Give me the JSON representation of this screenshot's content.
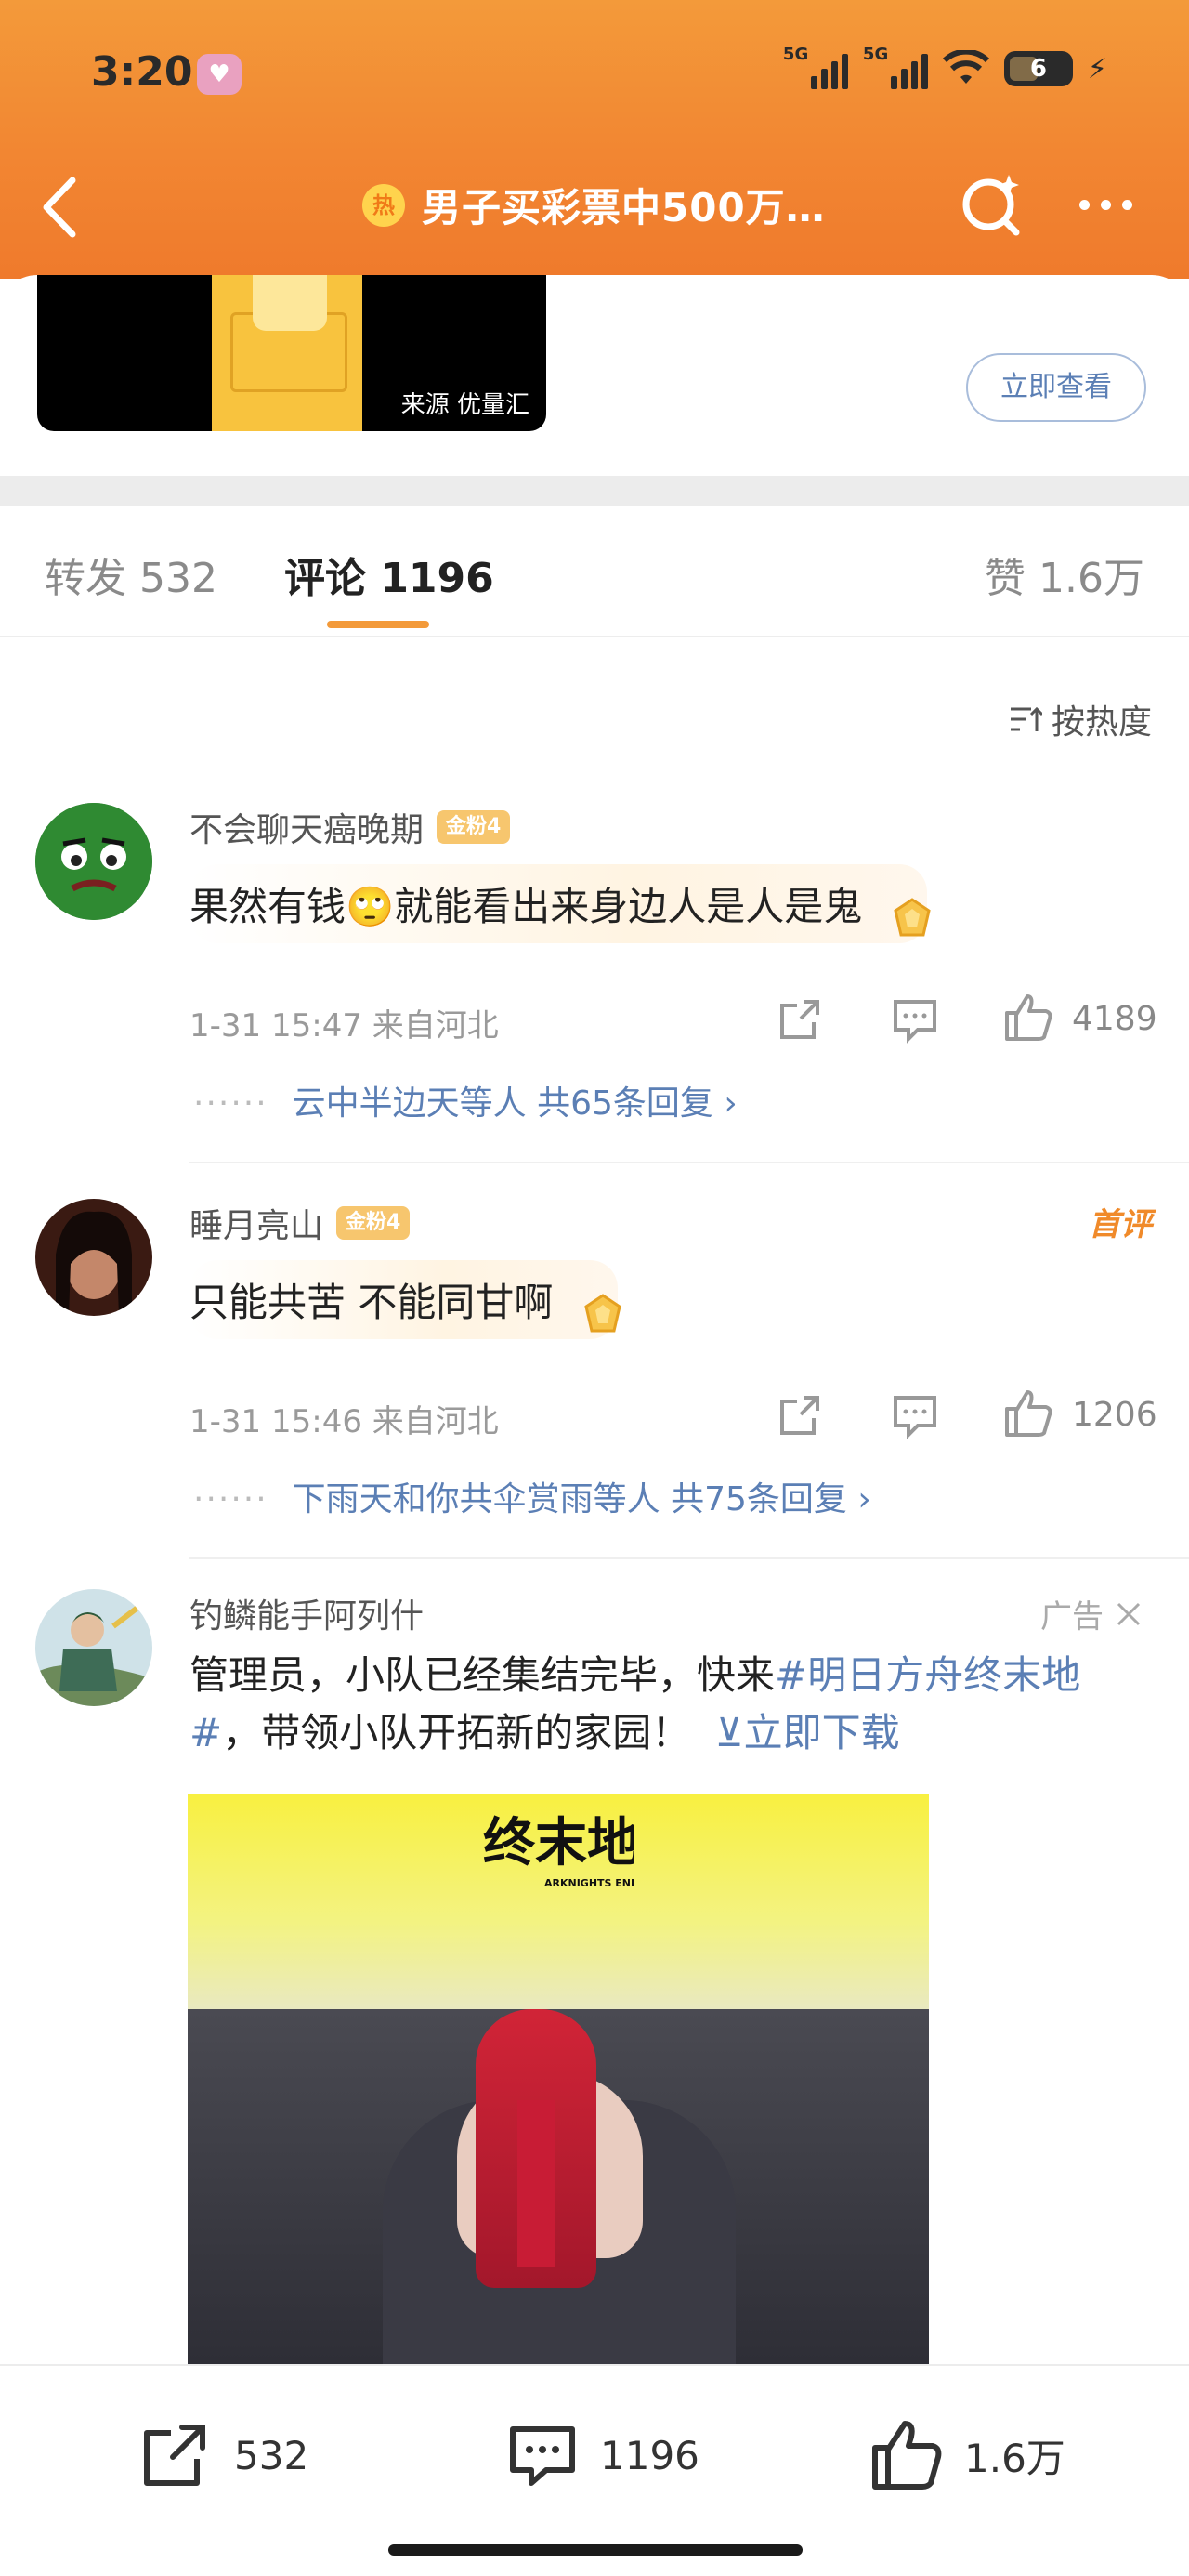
{
  "status_bar": {
    "time": "3:20",
    "signal1_label": "5G",
    "signal2_label": "5G",
    "battery": "6"
  },
  "header": {
    "hot_badge": "热",
    "title": "男子买彩票中500万…"
  },
  "video_card": {
    "source": "来源 优量汇",
    "view_button": "立即查看"
  },
  "tabs": {
    "repost": "转发 532",
    "comment": "评论 1196",
    "like": "赞 1.6万"
  },
  "sort_label": "按热度",
  "comments": [
    {
      "name": "不会聊天癌晚期",
      "badge": "金粉4",
      "text": "果然有钱🙄就能看出来身边人是人是鬼",
      "meta": "1-31 15:47  来自河北",
      "likes": "4189",
      "replies": "云中半边天等人  共65条回复 ›"
    },
    {
      "name": "睡月亮山",
      "badge": "金粉4",
      "tag": "首评",
      "text": "只能共苦 不能同甘啊",
      "meta": "1-31 15:46  来自河北",
      "likes": "1206",
      "replies": "下雨天和你共伞赏雨等人  共75条回复 ›"
    }
  ],
  "ad": {
    "name": "钓鳞能手阿列什",
    "tag": "广告",
    "text_before": "管理员，小队已经集结完毕，快来",
    "topic": "#明日方舟终末地#",
    "text_after": "，带领小队开拓新的家园！",
    "download": "⊻立即下载",
    "logo_text": "终末地",
    "logo_sub": "ARKNIGHTS ENDFIELD"
  },
  "bottom_bar": {
    "repost_count": "532",
    "comment_count": "1196",
    "like_count": "1.6万"
  },
  "colors": {
    "header_orange": "#f28632",
    "link_blue": "#5b7fb5",
    "tab_accent": "#f39a3a"
  }
}
